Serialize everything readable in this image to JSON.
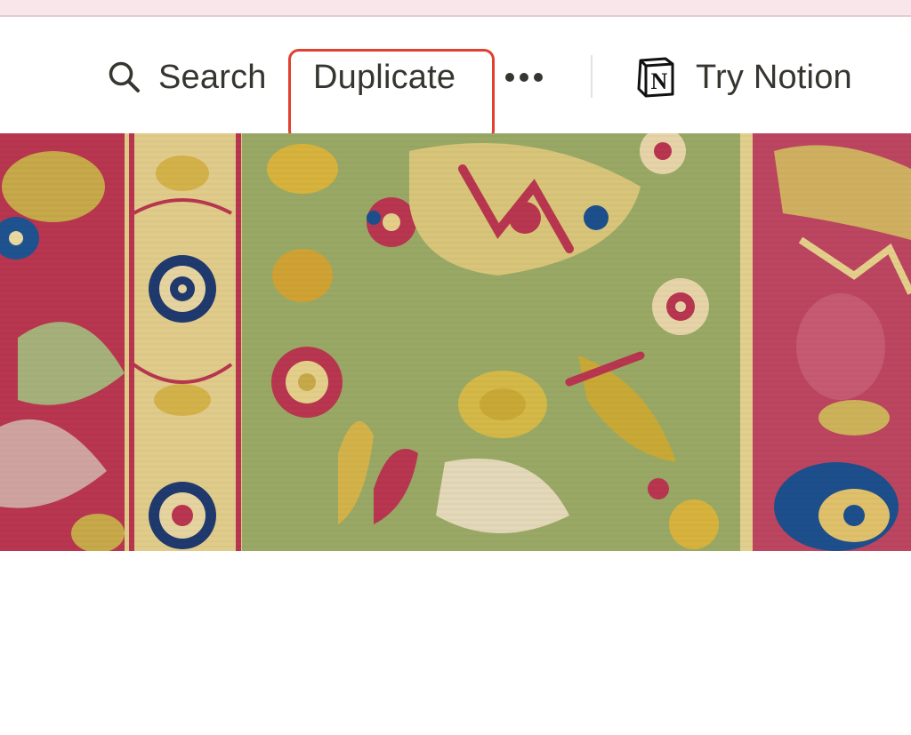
{
  "topbar": {
    "search_label": "Search",
    "duplicate_label": "Duplicate",
    "more_icon": "ellipsis-icon",
    "try_notion_label": "Try Notion",
    "logo_icon": "notion-logo-icon",
    "logo_letter": "N"
  },
  "highlight": {
    "color": "#e0402f"
  },
  "cover": {
    "description_icon": "carpet-cover-image",
    "colors": {
      "crimson": "#b8364f",
      "olive": "#96a862",
      "gold": "#d9b84c",
      "cream": "#e4cf8a",
      "navy": "#1d4f8c"
    }
  }
}
